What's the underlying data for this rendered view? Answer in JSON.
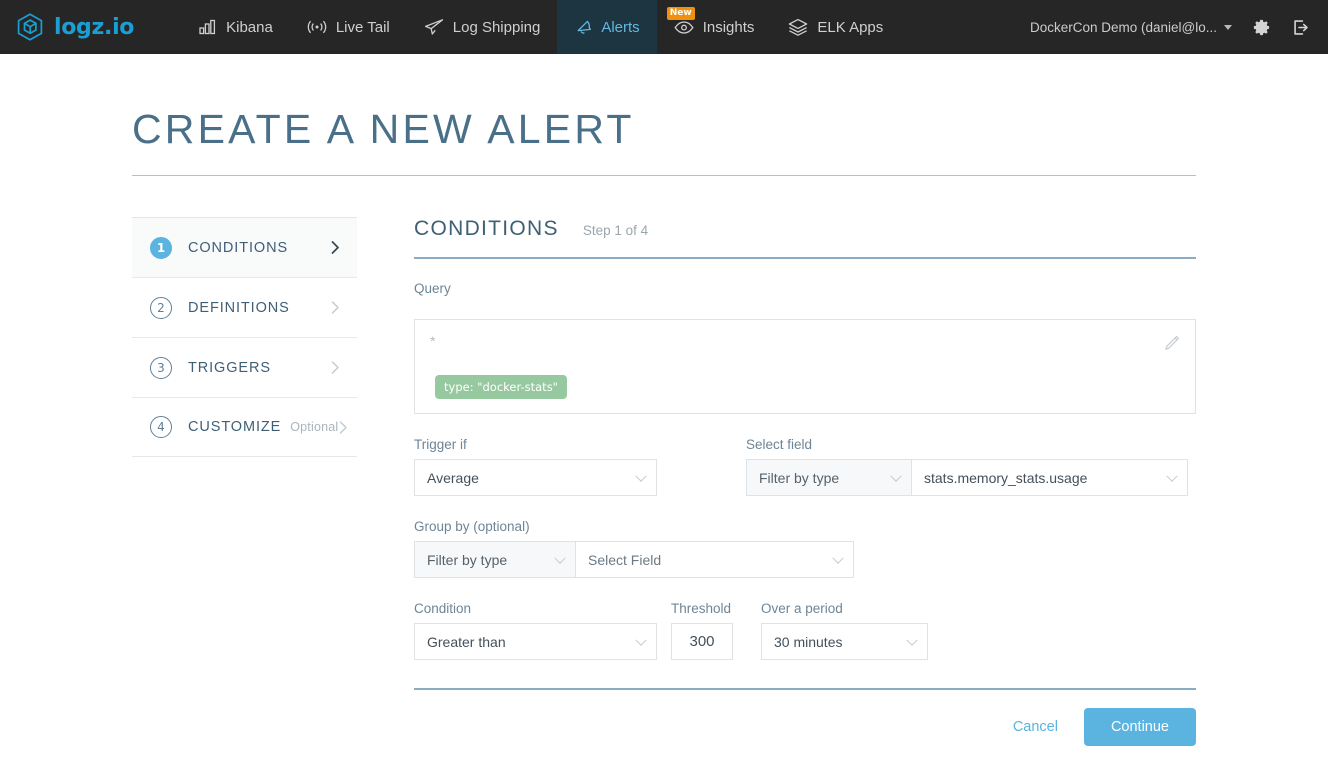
{
  "nav": {
    "brand": {
      "name": "logz.io",
      "icon": "cube-logo-icon"
    },
    "items": [
      {
        "label": "Kibana",
        "icon": "bar-chart-icon",
        "active": false,
        "badge": null
      },
      {
        "label": "Live Tail",
        "icon": "broadcast-icon",
        "active": false,
        "badge": null
      },
      {
        "label": "Log Shipping",
        "icon": "paper-plane-icon",
        "active": false,
        "badge": null
      },
      {
        "label": "Alerts",
        "icon": "bell-icon",
        "active": true,
        "badge": null
      },
      {
        "label": "Insights",
        "icon": "eye-icon",
        "active": false,
        "badge": "New"
      },
      {
        "label": "ELK Apps",
        "icon": "layers-icon",
        "active": false,
        "badge": null
      }
    ],
    "account": "DockerCon Demo (daniel@lo...",
    "settings_icon": "gear-icon",
    "logout_icon": "logout-icon"
  },
  "page": {
    "title": "CREATE A NEW ALERT"
  },
  "steps": [
    {
      "num": "1",
      "label": "CONDITIONS",
      "optional": "",
      "active": true
    },
    {
      "num": "2",
      "label": "DEFINITIONS",
      "optional": "",
      "active": false
    },
    {
      "num": "3",
      "label": "TRIGGERS",
      "optional": "",
      "active": false
    },
    {
      "num": "4",
      "label": "CUSTOMIZE",
      "optional": "Optional",
      "active": false
    }
  ],
  "panel": {
    "title": "CONDITIONS",
    "step_indicator": "Step 1 of 4",
    "query": {
      "label": "Query",
      "value": "*",
      "tag": "type: \"docker-stats\"",
      "edit_icon": "pencil-icon"
    },
    "trigger_if": {
      "label": "Trigger if",
      "value": "Average"
    },
    "select_field": {
      "label": "Select field",
      "filter_value": "Filter by type",
      "field_value": "stats.memory_stats.usage"
    },
    "group_by": {
      "label": "Group by (optional)",
      "filter_value": "Filter by type",
      "field_value": "Select Field"
    },
    "condition": {
      "label": "Condition",
      "value": "Greater than"
    },
    "threshold": {
      "label": "Threshold",
      "value": "300"
    },
    "period": {
      "label": "Over a period",
      "value": "30 minutes"
    }
  },
  "footer": {
    "cancel_label": "Cancel",
    "continue_label": "Continue"
  },
  "colors": {
    "nav_bg": "#262626",
    "brand_blue": "#1a9fd4",
    "accent_blue": "#5bb3e0",
    "active_tab_bg": "#1d3540",
    "tag_green": "#96c9a0",
    "badge_orange": "#f0910e",
    "title_slate": "#4a7089"
  }
}
